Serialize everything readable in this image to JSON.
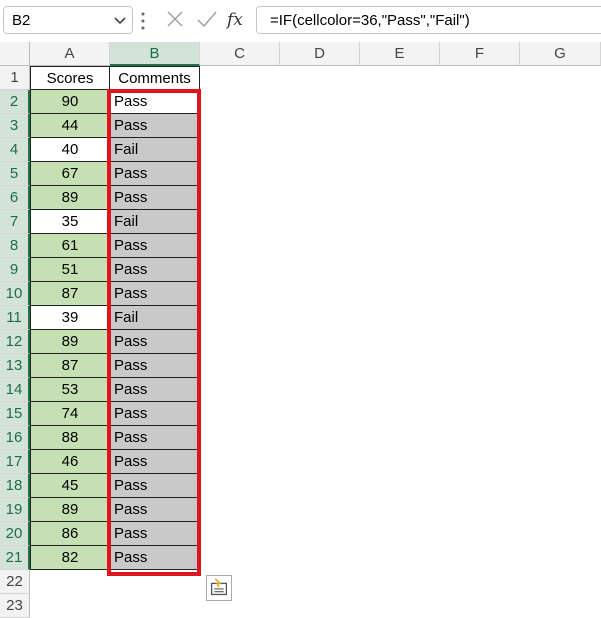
{
  "name_box": {
    "value": "B2"
  },
  "formula_bar": {
    "formula": "=IF(cellcolor=36,\"Pass\",\"Fail\")",
    "icons": [
      "cancel-icon",
      "enter-icon",
      "fx-icon"
    ]
  },
  "columns": [
    "A",
    "B",
    "C",
    "D",
    "E",
    "F",
    "G"
  ],
  "header_row": {
    "row": "1",
    "A": "Scores",
    "B": "Comments"
  },
  "rows": [
    {
      "row": "2",
      "score": "90",
      "comment": "Pass",
      "color": "green"
    },
    {
      "row": "3",
      "score": "44",
      "comment": "Pass",
      "color": "green"
    },
    {
      "row": "4",
      "score": "40",
      "comment": "Fail",
      "color": "white"
    },
    {
      "row": "5",
      "score": "67",
      "comment": "Pass",
      "color": "green"
    },
    {
      "row": "6",
      "score": "89",
      "comment": "Pass",
      "color": "green"
    },
    {
      "row": "7",
      "score": "35",
      "comment": "Fail",
      "color": "white"
    },
    {
      "row": "8",
      "score": "61",
      "comment": "Pass",
      "color": "green"
    },
    {
      "row": "9",
      "score": "51",
      "comment": "Pass",
      "color": "green"
    },
    {
      "row": "10",
      "score": "87",
      "comment": "Pass",
      "color": "green"
    },
    {
      "row": "11",
      "score": "39",
      "comment": "Fail",
      "color": "white"
    },
    {
      "row": "12",
      "score": "89",
      "comment": "Pass",
      "color": "green"
    },
    {
      "row": "13",
      "score": "87",
      "comment": "Pass",
      "color": "green"
    },
    {
      "row": "14",
      "score": "53",
      "comment": "Pass",
      "color": "green"
    },
    {
      "row": "15",
      "score": "74",
      "comment": "Pass",
      "color": "green"
    },
    {
      "row": "16",
      "score": "88",
      "comment": "Pass",
      "color": "green"
    },
    {
      "row": "17",
      "score": "46",
      "comment": "Pass",
      "color": "green"
    },
    {
      "row": "18",
      "score": "45",
      "comment": "Pass",
      "color": "green"
    },
    {
      "row": "19",
      "score": "89",
      "comment": "Pass",
      "color": "green"
    },
    {
      "row": "20",
      "score": "86",
      "comment": "Pass",
      "color": "green"
    },
    {
      "row": "21",
      "score": "82",
      "comment": "Pass",
      "color": "green"
    }
  ],
  "extra_rows": [
    "22",
    "23"
  ],
  "colors": {
    "score_fill": "#c6e0b4",
    "comment_fill": "#c9c9c9",
    "highlight_border": "#e0141e",
    "selection_accent": "#217346"
  },
  "quick_analysis": {
    "icon": "quick-analysis-icon"
  }
}
